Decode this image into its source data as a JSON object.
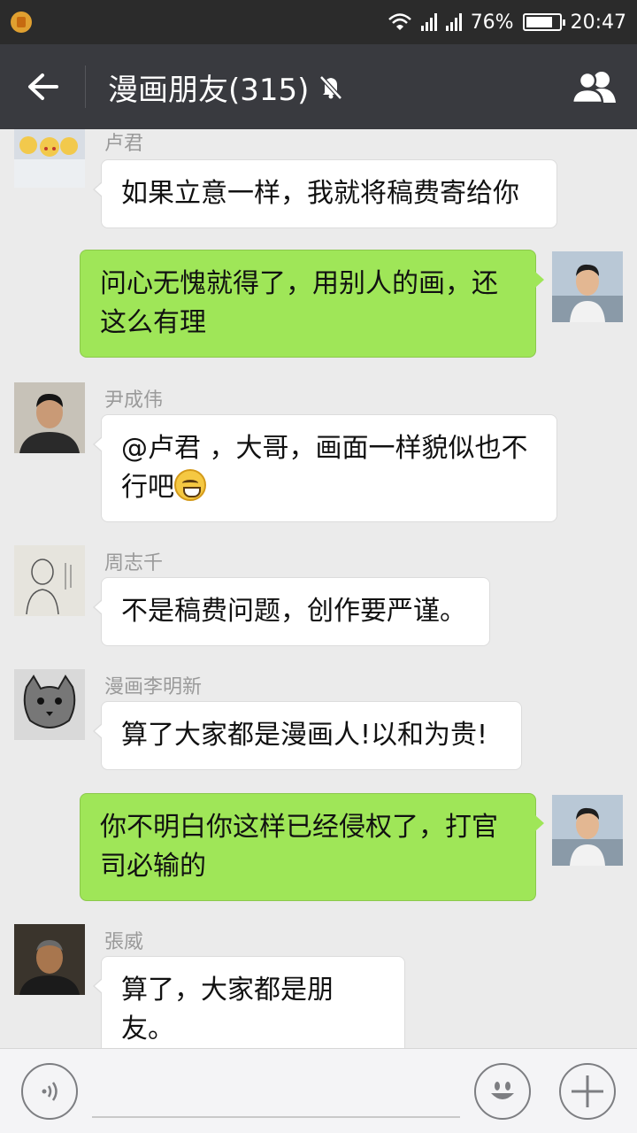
{
  "status_bar": {
    "battery_percent": "76%",
    "time": "20:47",
    "icons": [
      "app-notification-icon",
      "wifi-icon",
      "signal-icon",
      "signal-icon",
      "battery-icon"
    ]
  },
  "header": {
    "title": "漫画朋友(315)",
    "icons": [
      "back-arrow-icon",
      "mute-bell-icon",
      "group-members-icon"
    ]
  },
  "messages": [
    {
      "direction": "in",
      "sender": "卢君",
      "text": "如果立意一样，我就将稿费寄给你"
    },
    {
      "direction": "out",
      "sender": "",
      "line1": "问心无愧就得了，用别人的画，还",
      "line2": "这么有理"
    },
    {
      "direction": "in",
      "sender": "尹成伟",
      "line1": "@卢君 ，大哥，画面一样貌似也不",
      "line2": "行吧",
      "emoji": "grinning-face-icon"
    },
    {
      "direction": "in",
      "sender": "周志千",
      "text": "不是稿费问题，创作要严谨。"
    },
    {
      "direction": "in",
      "sender": "漫画李明新",
      "text": "算了大家都是漫画人!以和为贵!"
    },
    {
      "direction": "out",
      "sender": "",
      "line1": "你不明白你这样已经侵权了，打官",
      "line2": "司必输的"
    },
    {
      "direction": "in",
      "sender": "張威",
      "text": "算了，大家都是朋友。"
    }
  ],
  "input_bar": {
    "icons": [
      "voice-icon",
      "emoji-icon",
      "plus-icon"
    ],
    "text_value": ""
  },
  "colors": {
    "title_bar": "#393a3f",
    "status_bar": "#2b2b2b",
    "chat_background": "#ebebeb",
    "outgoing_bubble": "#9fe658",
    "incoming_bubble": "#ffffff"
  }
}
